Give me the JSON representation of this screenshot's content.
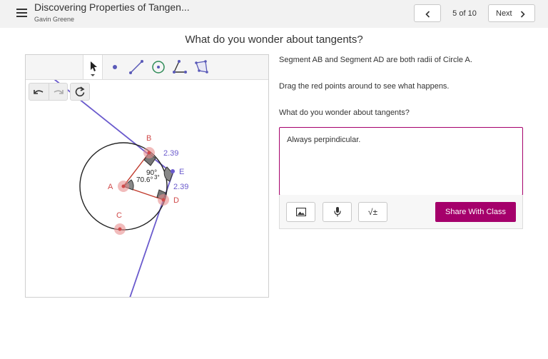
{
  "header": {
    "title": "Discovering Properties of Tangen...",
    "author": "Gavin Greene",
    "prev_icon": "chevron-left-icon",
    "page_counter": "5 of 10",
    "next_label": "Next"
  },
  "question": {
    "heading": "What do you wonder about tangents?"
  },
  "applet": {
    "tools": [
      "move-tool",
      "point-tool",
      "segment-tool",
      "circle-tool",
      "angle-tool",
      "polygon-tool"
    ],
    "points": {
      "A": "A",
      "B": "B",
      "C": "C",
      "D": "D",
      "E": "E"
    },
    "measures": {
      "top_length": "2.39",
      "bottom_length": "2.39",
      "angle_top": "90°",
      "angle_overlap": "70.6°",
      "angle_small": "3°"
    },
    "colors": {
      "circle": "#222222",
      "radius": "#c0392b",
      "tangent": "#6a5acd",
      "point": "#e89090"
    }
  },
  "instructions": {
    "line1": "Segment AB and Segment AD are both radii of Circle A.",
    "line2": "Drag the red points around to see what happens.",
    "line3": "What do you wonder about tangents?"
  },
  "response": {
    "text": "Always perpindicular.",
    "math_label": "√±",
    "share_label": "Share With Class",
    "accent": "#a5006b"
  }
}
